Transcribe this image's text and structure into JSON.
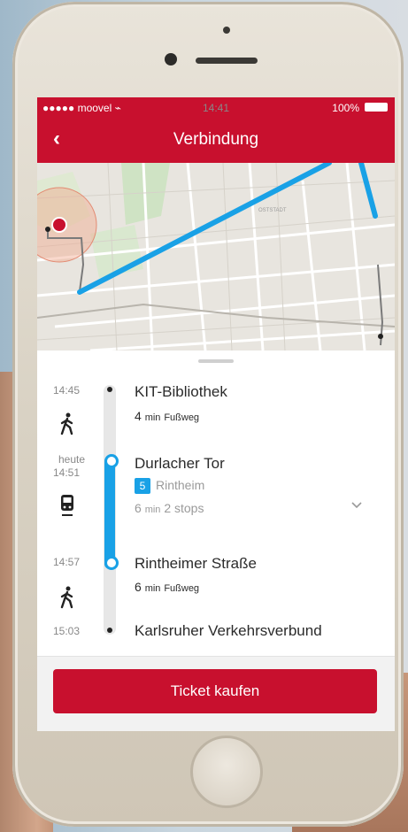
{
  "status_bar": {
    "carrier": "●●●●● moovel ⌁",
    "time": "14:41",
    "battery": "100%"
  },
  "nav": {
    "back_icon": "chevron-left-icon",
    "title": "Verbindung"
  },
  "map": {
    "district_label": "OSTSTADT",
    "route_color": "#19a1e6"
  },
  "itinerary": [
    {
      "time": "14:45",
      "stop": "KIT-Bibliothek",
      "walk_min": "4",
      "walk_unit": "min",
      "walk_label": "Fußweg"
    },
    {
      "time_prefix": "heute",
      "time": "14:51",
      "stop": "Durlacher Tor",
      "line": "5",
      "direction": "Rintheim",
      "ride_min": "6",
      "ride_unit": "min",
      "stops": "2 stops"
    },
    {
      "time": "14:57",
      "stop": "Rintheimer Straße",
      "walk_min": "6",
      "walk_unit": "min",
      "walk_label": "Fußweg"
    },
    {
      "time": "15:03",
      "stop": "Karlsruher Verkehrsverbund"
    }
  ],
  "footer": {
    "button_label": "Ticket kaufen"
  },
  "colors": {
    "brand": "#c8102e",
    "transit": "#19a1e6"
  }
}
